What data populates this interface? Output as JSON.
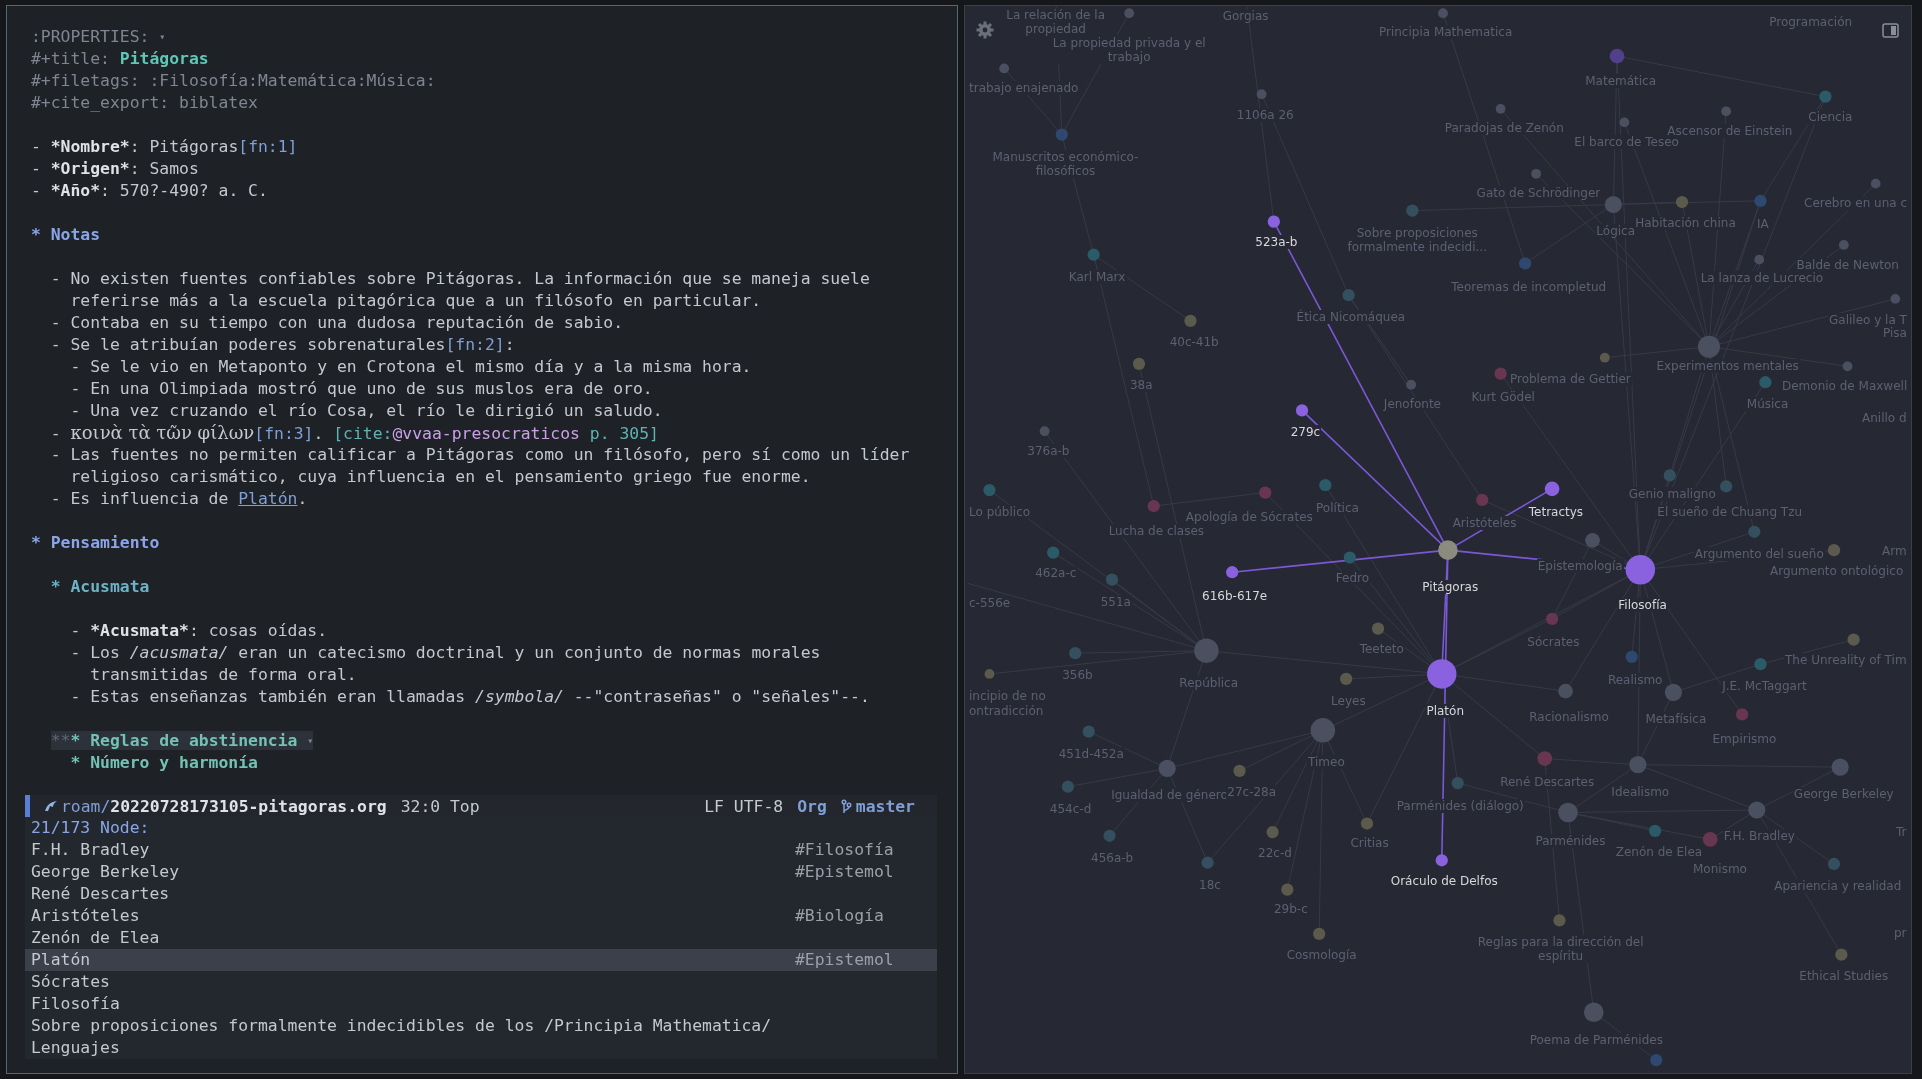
{
  "editor": {
    "lines": [
      {
        "kind": "text",
        "segments": [
          {
            "kind": "meta",
            "text": ":PROPERTIES: "
          },
          {
            "kind": "fold",
            "text": "▾"
          }
        ]
      },
      {
        "kind": "text",
        "segments": [
          {
            "kind": "meta",
            "text": "#+title: "
          },
          {
            "kind": "title",
            "text": "Pitágoras"
          }
        ]
      },
      {
        "kind": "text",
        "segments": [
          {
            "kind": "meta",
            "text": "#+filetags: :Filosofía:Matemática:Música:"
          }
        ]
      },
      {
        "kind": "text",
        "segments": [
          {
            "kind": "meta",
            "text": "#+cite_export: biblatex"
          }
        ]
      },
      {
        "kind": "blank"
      },
      {
        "kind": "text",
        "segments": [
          {
            "kind": "plain",
            "text": "- "
          },
          {
            "kind": "bold",
            "text": "*Nombre*"
          },
          {
            "kind": "plain",
            "text": ": Pitágoras"
          },
          {
            "kind": "fn",
            "text": "[fn:1]"
          }
        ]
      },
      {
        "kind": "text",
        "segments": [
          {
            "kind": "plain",
            "text": "- "
          },
          {
            "kind": "bold",
            "text": "*Origen*"
          },
          {
            "kind": "plain",
            "text": ": Samos"
          }
        ]
      },
      {
        "kind": "text",
        "segments": [
          {
            "kind": "plain",
            "text": "- "
          },
          {
            "kind": "bold",
            "text": "*Año*"
          },
          {
            "kind": "plain",
            "text": ": 570?-490? a. C."
          }
        ]
      },
      {
        "kind": "blank"
      },
      {
        "kind": "text",
        "segments": [
          {
            "kind": "heading1",
            "text": "* Notas"
          }
        ]
      },
      {
        "kind": "blank"
      },
      {
        "kind": "text",
        "segments": [
          {
            "kind": "plain",
            "text": "  - No existen fuentes confiables sobre Pitágoras. La información que se maneja suele"
          }
        ]
      },
      {
        "kind": "text",
        "segments": [
          {
            "kind": "plain",
            "text": "    referirse más a la escuela pitagórica que a un filósofo en particular."
          }
        ]
      },
      {
        "kind": "text",
        "segments": [
          {
            "kind": "plain",
            "text": "  - Contaba en su tiempo con una dudosa reputación de sabio."
          }
        ]
      },
      {
        "kind": "text",
        "segments": [
          {
            "kind": "plain",
            "text": "  - Se le atribuían poderes sobrenaturales"
          },
          {
            "kind": "fn",
            "text": "[fn:2]"
          },
          {
            "kind": "plain",
            "text": ":"
          }
        ]
      },
      {
        "kind": "text",
        "segments": [
          {
            "kind": "plain",
            "text": "    - Se le vio en Metaponto y en Crotona el mismo día y a la misma hora."
          }
        ]
      },
      {
        "kind": "text",
        "segments": [
          {
            "kind": "plain",
            "text": "    - En una Olimpiada mostró que uno de sus muslos era de oro."
          }
        ]
      },
      {
        "kind": "text",
        "segments": [
          {
            "kind": "plain",
            "text": "    - Una vez cruzando el río Cosa, el río le dirigió un saludo."
          }
        ]
      },
      {
        "kind": "text",
        "segments": [
          {
            "kind": "plain",
            "text": "  - "
          },
          {
            "kind": "greek",
            "text": "κοινὰ τὰ τῶν φίλων"
          },
          {
            "kind": "fn",
            "text": "[fn:3]"
          },
          {
            "kind": "plain",
            "text": ". "
          },
          {
            "kind": "cite",
            "text": "[cite:"
          },
          {
            "kind": "citekey",
            "text": "@vvaa-presocraticos"
          },
          {
            "kind": "cite",
            "text": " p. 305]"
          }
        ]
      },
      {
        "kind": "text",
        "segments": [
          {
            "kind": "plain",
            "text": "  - Las fuentes no permiten calificar a Pitágoras como un filósofo, pero sí como un líder"
          }
        ]
      },
      {
        "kind": "text",
        "segments": [
          {
            "kind": "plain",
            "text": "    religioso carismático, cuya influencia en el pensamiento griego fue enorme."
          }
        ]
      },
      {
        "kind": "text",
        "segments": [
          {
            "kind": "plain",
            "text": "  - Es influencia de "
          },
          {
            "kind": "link",
            "text": "Platón"
          },
          {
            "kind": "plain",
            "text": "."
          }
        ]
      },
      {
        "kind": "blank"
      },
      {
        "kind": "text",
        "segments": [
          {
            "kind": "heading1",
            "text": "* Pensamiento"
          }
        ]
      },
      {
        "kind": "blank"
      },
      {
        "kind": "text",
        "segments": [
          {
            "kind": "heading2",
            "text": "  * Acusmata"
          }
        ]
      },
      {
        "kind": "blank"
      },
      {
        "kind": "text",
        "segments": [
          {
            "kind": "plain",
            "text": "    - "
          },
          {
            "kind": "bold",
            "text": "*Acusmata*"
          },
          {
            "kind": "plain",
            "text": ": cosas oídas."
          }
        ]
      },
      {
        "kind": "text",
        "segments": [
          {
            "kind": "plain",
            "text": "    - Los "
          },
          {
            "kind": "italic",
            "text": "/acusmata/"
          },
          {
            "kind": "plain",
            "text": " eran un catecismo doctrinal y un conjunto de normas morales"
          }
        ]
      },
      {
        "kind": "text",
        "segments": [
          {
            "kind": "plain",
            "text": "      transmitidas de forma oral."
          }
        ]
      },
      {
        "kind": "text",
        "segments": [
          {
            "kind": "plain",
            "text": "    - Estas enseñanzas también eran llamadas "
          },
          {
            "kind": "italic",
            "text": "/symbola/"
          },
          {
            "kind": "plain",
            "text": " --\"contraseñas\" o \"señales\"--."
          }
        ]
      },
      {
        "kind": "blank"
      },
      {
        "kind": "folded",
        "segments": [
          {
            "kind": "stars",
            "text": "**"
          },
          {
            "kind": "heading3",
            "text": "* Reglas de abstinencia "
          },
          {
            "kind": "fold",
            "text": "▾"
          }
        ]
      },
      {
        "kind": "text",
        "segments": [
          {
            "kind": "heading3",
            "text": "    * Número y harmonía"
          }
        ]
      }
    ]
  },
  "mode_line": {
    "directory": "roam/",
    "file": "20220728173105-pitagoras.org",
    "position": "32:0 Top",
    "encoding": "LF UTF-8",
    "mode": "Org",
    "branch": "master"
  },
  "minibuffer": {
    "prompt": "21/173 Node:",
    "rows": [
      {
        "title": "F.H. Bradley",
        "tag": "#Filosofía",
        "selected": false
      },
      {
        "title": "George Berkeley",
        "tag": "#Epistemol",
        "selected": false
      },
      {
        "title": "René Descartes",
        "selected": false
      },
      {
        "title": "Aristóteles",
        "tag": "#Biología",
        "selected": false
      },
      {
        "title": "Zenón de Elea",
        "selected": false
      },
      {
        "title": "Platón",
        "tag": "#Epistemol",
        "selected": true
      },
      {
        "title": "Sócrates",
        "selected": false
      },
      {
        "title": "Filosofía",
        "selected": false
      },
      {
        "title": "Sobre proposiciones formalmente indecidibles de los /Principia Mathematica/",
        "selected": false
      },
      {
        "title": "Lenguajes",
        "selected": false
      }
    ]
  },
  "graph": {
    "nodes": [
      {
        "label": "Gorgias",
        "kind": "other"
      },
      {
        "label": "La relación de la propiedad",
        "kind": "other"
      },
      {
        "label": "La propiedad privada y el trabajo",
        "kind": "other",
        "color": "#4b5060"
      },
      {
        "label": "Principia Mathematica",
        "kind": "other",
        "color": "#4b5060"
      },
      {
        "label": "Programación",
        "kind": "other"
      },
      {
        "label": "trabajo enajenado",
        "kind": "other",
        "color": "#4b5060"
      },
      {
        "label": "Matemática",
        "kind": "other",
        "color": "#52408c"
      },
      {
        "label": "1106a 26",
        "kind": "other",
        "color": "#4b5060"
      },
      {
        "label": "Manuscritos económico-filosóficos",
        "kind": "other",
        "color": "#2e4870"
      },
      {
        "label": "Paradojas de Zenón",
        "kind": "other",
        "color": "#4b5060"
      },
      {
        "label": "El barco de Teseo",
        "kind": "other",
        "color": "#4b5060"
      },
      {
        "label": "Ascensor de Einstein",
        "kind": "other",
        "color": "#4b5060"
      },
      {
        "label": "Ciencia",
        "kind": "other",
        "color": "#2b5b66"
      },
      {
        "label": "Gato de Schrödinger",
        "kind": "other",
        "color": "#4b5060"
      },
      {
        "label": "Lógica",
        "kind": "other",
        "color": "#4b5060"
      },
      {
        "label": "Habitación china",
        "kind": "other",
        "color": "#5b5a4c"
      },
      {
        "label": "IA",
        "kind": "other",
        "color": "#2e4870"
      },
      {
        "label": "Cerebro en una c",
        "kind": "other",
        "color": "#4b5060"
      },
      {
        "label": "523a-b",
        "kind": "linked",
        "color": "#8a62e0"
      },
      {
        "label": "Sobre proposiciones formalmente indecidi...",
        "kind": "other",
        "color": "#34505e"
      },
      {
        "label": "Karl Marx",
        "kind": "other",
        "color": "#2b5b66"
      },
      {
        "label": "Teoremas de incompletud",
        "kind": "other",
        "color": "#2e4870"
      },
      {
        "label": "La lanza de Lucrecio",
        "kind": "other",
        "color": "#4b5060"
      },
      {
        "label": "Balde de Newton",
        "kind": "other",
        "color": "#4b5060"
      },
      {
        "label": "Ética Nicomáquea",
        "kind": "other",
        "color": "#34505e"
      },
      {
        "label": "Galileo y la T",
        "kind": "other",
        "color": "#4b5060"
      },
      {
        "label": "Pisa",
        "kind": "other"
      },
      {
        "label": "40c-41b",
        "kind": "other",
        "color": "#5b5a4c"
      },
      {
        "label": "38a",
        "kind": "other",
        "color": "#5b5a4c"
      },
      {
        "label": "Jenofonte",
        "kind": "other",
        "color": "#4b5060"
      },
      {
        "label": "Kurt Gödel",
        "kind": "other",
        "color": "#683650"
      },
      {
        "label": "Problema de Gettier",
        "kind": "other",
        "color": "#5b5a4c"
      },
      {
        "label": "Experimentos mentales",
        "kind": "other",
        "color": "#4b5060"
      },
      {
        "label": "Música",
        "kind": "other",
        "color": "#2b5b66"
      },
      {
        "label": "Demonio de Maxwell",
        "kind": "other",
        "color": "#4b5060"
      },
      {
        "label": "Anillo d",
        "kind": "other"
      },
      {
        "label": "279c",
        "kind": "linked",
        "color": "#8a62e0"
      },
      {
        "label": "376a-b",
        "kind": "other",
        "color": "#4b5060"
      },
      {
        "label": "Lo público",
        "kind": "other",
        "color": "#2b5b66"
      },
      {
        "label": "Lucha de clases",
        "kind": "other",
        "color": "#683650"
      },
      {
        "label": "Apología de Sócrates",
        "kind": "other",
        "color": "#683650"
      },
      {
        "label": "Política",
        "kind": "other",
        "color": "#2b5b66"
      },
      {
        "label": "Aristóteles",
        "kind": "other",
        "color": "#683650"
      },
      {
        "label": "Tetractys",
        "kind": "linked",
        "color": "#8a62e0"
      },
      {
        "label": "Genio maligno",
        "kind": "other",
        "color": "#34505e"
      },
      {
        "label": "El sueño de Chuang Tzu",
        "kind": "other",
        "color": "#34505e"
      },
      {
        "label": "Epistemología",
        "kind": "other",
        "color": "#4b5060"
      },
      {
        "label": "Filosofía",
        "kind": "linked",
        "color": "#8a62e0"
      },
      {
        "label": "Argumento del sueño",
        "kind": "other",
        "color": "#34505e"
      },
      {
        "label": "Arm",
        "kind": "other"
      },
      {
        "label": "Argumento ontológico",
        "kind": "other",
        "color": "#5b5a4c"
      },
      {
        "label": "Pitágoras",
        "kind": "current",
        "color": "#8c8b80"
      },
      {
        "label": "616b-617e",
        "kind": "linked",
        "color": "#8a62e0"
      },
      {
        "label": "Fedro",
        "kind": "other",
        "color": "#2b5b66"
      },
      {
        "label": "462a-c",
        "kind": "other",
        "color": "#2b5b66"
      },
      {
        "label": "c-556e",
        "kind": "other"
      },
      {
        "label": "551a",
        "kind": "other",
        "color": "#34505e"
      },
      {
        "label": "Sócrates",
        "kind": "other",
        "color": "#683650"
      },
      {
        "label": "Teeteto",
        "kind": "other",
        "color": "#5b5a4c"
      },
      {
        "label": "República",
        "kind": "other",
        "color": "#4b5060"
      },
      {
        "label": "356b",
        "kind": "other",
        "color": "#34505e"
      },
      {
        "label": "incipio de no",
        "kind": "other",
        "color": "#5b5a4c"
      },
      {
        "label": "ontradicción",
        "kind": "other"
      },
      {
        "label": "Platón",
        "kind": "linked",
        "color": "#8a62e0"
      },
      {
        "label": "Leyes",
        "kind": "other",
        "color": "#5b5a4c"
      },
      {
        "label": "Realismo",
        "kind": "other",
        "color": "#2e4870"
      },
      {
        "label": "Racionalismo",
        "kind": "other",
        "color": "#4b5060"
      },
      {
        "label": "Metafísica",
        "kind": "other",
        "color": "#4b5060"
      },
      {
        "label": "J.E. McTaggart",
        "kind": "other",
        "color": "#2b5b66"
      },
      {
        "label": "The Unreality of Tim",
        "kind": "other",
        "color": "#5b5a4c"
      },
      {
        "label": "Empirismo",
        "kind": "other",
        "color": "#683650"
      },
      {
        "label": "451d-452a",
        "kind": "other",
        "color": "#34505e"
      },
      {
        "label": "Timeo",
        "kind": "other",
        "color": "#4b5060"
      },
      {
        "label": "Igualdad de género",
        "kind": "other",
        "color": "#4b5060"
      },
      {
        "label": "27c-28a",
        "kind": "other",
        "color": "#5b5a4c"
      },
      {
        "label": "454c-d",
        "kind": "other",
        "color": "#34505e"
      },
      {
        "label": "René Descartes",
        "kind": "other",
        "color": "#683650"
      },
      {
        "label": "Parménides (diálogo)",
        "kind": "other",
        "color": "#34505e"
      },
      {
        "label": "Idealismo",
        "kind": "other",
        "color": "#4b5060"
      },
      {
        "label": "George Berkeley",
        "kind": "other",
        "color": "#4b5060"
      },
      {
        "label": "Critias",
        "kind": "other",
        "color": "#5b5a4c"
      },
      {
        "label": "22c-d",
        "kind": "other",
        "color": "#5b5a4c"
      },
      {
        "label": "Parménides",
        "kind": "other",
        "color": "#4b5060"
      },
      {
        "label": "Zenón de Elea",
        "kind": "other",
        "color": "#2b5b66"
      },
      {
        "label": "F.H. Bradley",
        "kind": "other",
        "color": "#4b5060"
      },
      {
        "label": "Monismo",
        "kind": "other",
        "color": "#683650"
      },
      {
        "label": "Tr",
        "kind": "other"
      },
      {
        "label": "456a-b",
        "kind": "other",
        "color": "#34505e"
      },
      {
        "label": "Oráculo de Delfos",
        "kind": "linked",
        "color": "#8a62e0"
      },
      {
        "label": "18c",
        "kind": "other",
        "color": "#34505e"
      },
      {
        "label": "Apariencia y realidad",
        "kind": "other",
        "color": "#34505e"
      },
      {
        "label": "29b-c",
        "kind": "other",
        "color": "#5b5a4c"
      },
      {
        "label": "pr",
        "kind": "other"
      },
      {
        "label": "Cosmología",
        "kind": "other",
        "color": "#5b5a4c"
      },
      {
        "label": "Reglas para la dirección del espíritu",
        "kind": "other",
        "color": "#5b5a4c"
      },
      {
        "label": "Ethical Studies",
        "kind": "other",
        "color": "#5b5a4c"
      },
      {
        "label": "Poema de Parménides",
        "kind": "other",
        "color": "#4b5060"
      },
      {
        "kind": "other",
        "color": "#2e4870"
      }
    ]
  }
}
